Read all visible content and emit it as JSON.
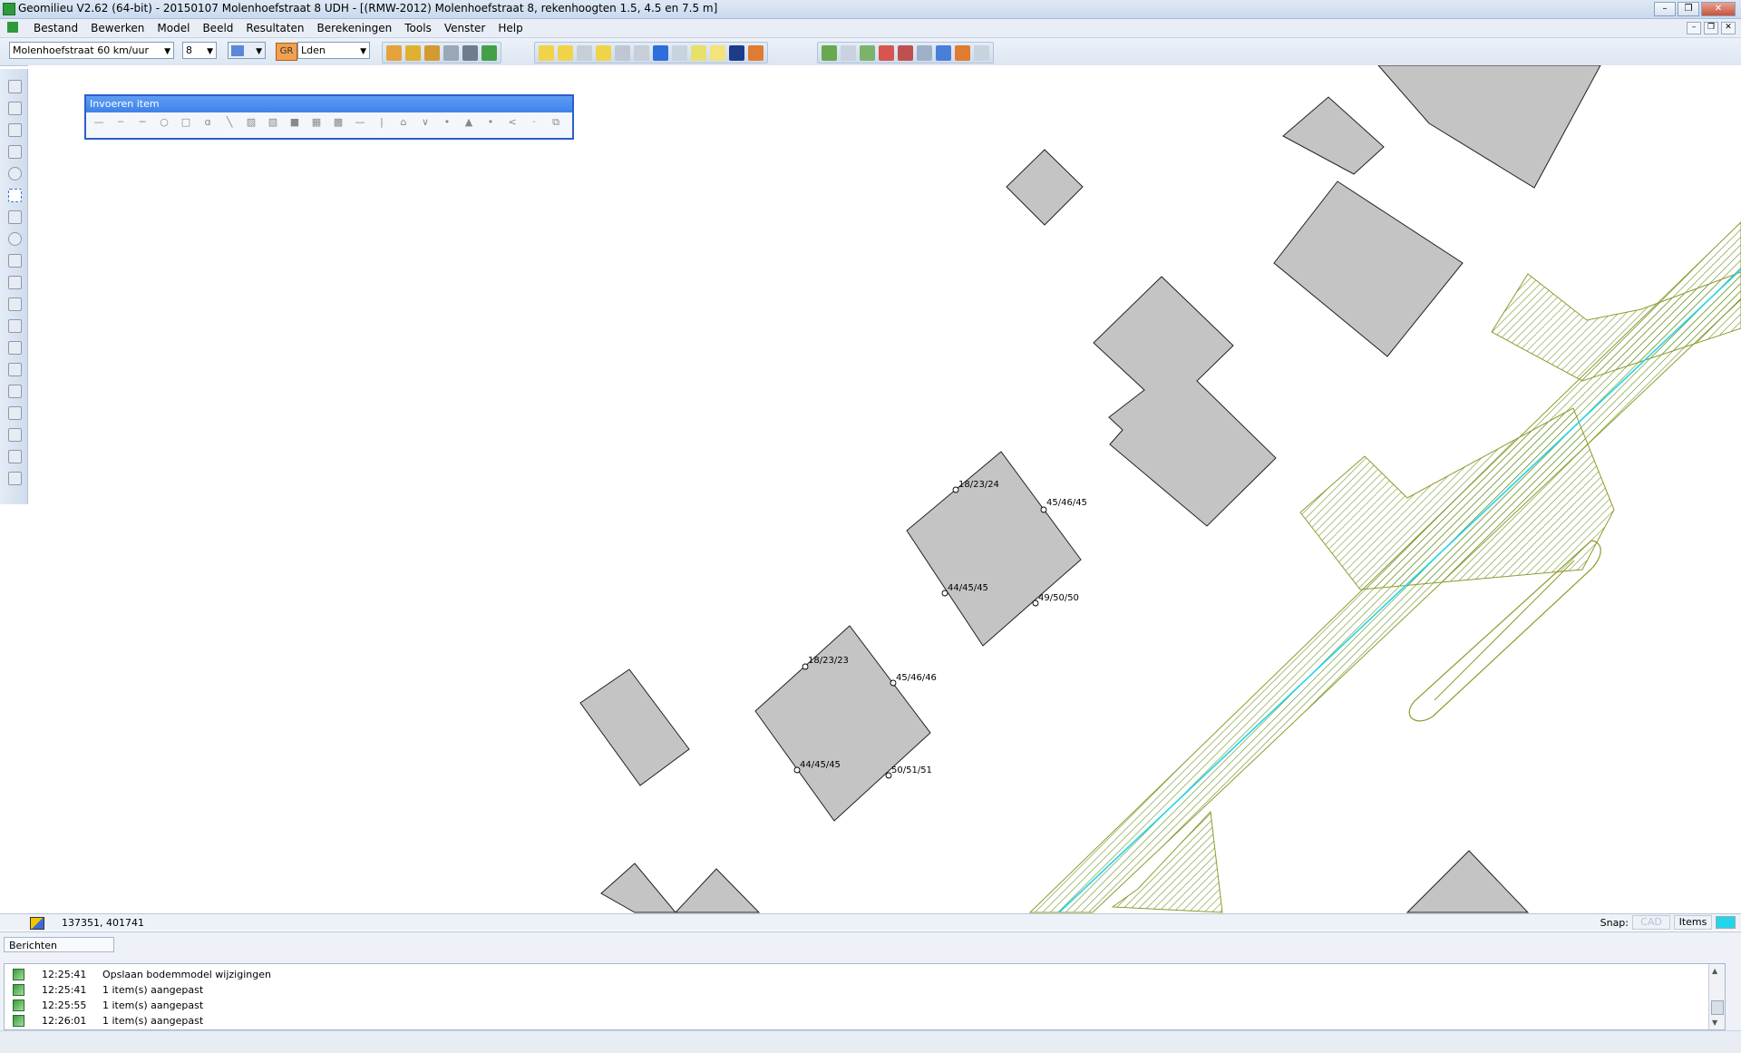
{
  "window": {
    "title": "Geomilieu V2.62 (64-bit) - 20150107 Molenhoefstraat 8 UDH - [(RMW-2012) Molenhoefstraat 8, rekenhoogten 1.5, 4.5 en 7.5 m]",
    "controls": [
      "–",
      "❐",
      "✕"
    ],
    "mdi_controls": [
      "–",
      "❐",
      "✕"
    ]
  },
  "menu": {
    "items": [
      "Bestand",
      "Bewerken",
      "Model",
      "Beeld",
      "Resultaten",
      "Berekeningen",
      "Tools",
      "Venster",
      "Help"
    ]
  },
  "toolbar": {
    "road_select": "Molenhoefstraat 60 km/uur",
    "number_select": "8",
    "gr_label": "GR",
    "period_select": "Lden"
  },
  "invoer": {
    "title": "Invoeren item"
  },
  "map": {
    "labels": [
      "18/23/24",
      "45/46/45",
      "44/45/45",
      "49/50/50",
      "18/23/23",
      "45/46/46",
      "44/45/45",
      "50/51/51"
    ]
  },
  "status": {
    "coords": "137351, 401741",
    "snap_label": "Snap:",
    "cad": "CAD",
    "items": "Items"
  },
  "messages": {
    "tab": "Berichten",
    "rows": [
      {
        "time": "12:25:41",
        "text": "Opslaan bodemmodel wijzigingen"
      },
      {
        "time": "12:25:41",
        "text": "1 item(s) aangepast"
      },
      {
        "time": "12:25:55",
        "text": "1 item(s) aangepast"
      },
      {
        "time": "12:26:01",
        "text": "1 item(s) aangepast"
      }
    ]
  },
  "colors": {
    "building": "#c4c4c4",
    "hatch": "#5f8f1a",
    "road_centerline": "#22d5ea",
    "outline": "#8f9a2a"
  }
}
